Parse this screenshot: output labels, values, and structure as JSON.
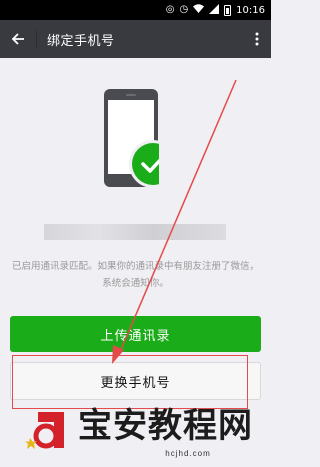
{
  "status_bar": {
    "time": "10:16",
    "icons": [
      "headset-icon",
      "alarm-icon",
      "wifi-icon",
      "signal-icon",
      "battery-icon"
    ]
  },
  "header": {
    "title": "绑定手机号",
    "back_icon": "arrow-left-icon",
    "more_icon": "more-vertical-icon",
    "background": "#393a3f"
  },
  "main": {
    "illustration": {
      "icons": [
        "phone-icon",
        "check-circle-icon"
      ],
      "check_color": "#1aad19"
    },
    "hint": "已启用通讯录匹配。如果你的通讯录中有朋友注册了微信，系统会通知你。",
    "upload_button": "上传通讯录",
    "change_button": "更换手机号",
    "accent": "#1aad19"
  },
  "watermark": {
    "name": "宝安教程网",
    "url": "hcjhd.com",
    "annotation_color": "#e54a4a"
  }
}
